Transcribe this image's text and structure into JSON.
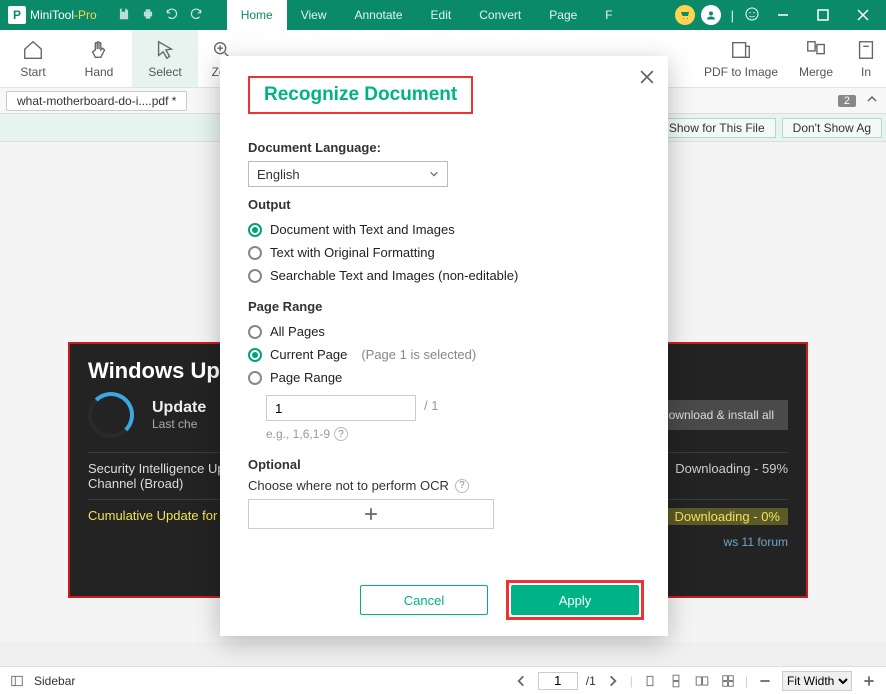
{
  "app": {
    "name_main": "MiniTool",
    "name_suffix": "-Pro"
  },
  "menu": {
    "items": [
      "Home",
      "View",
      "Annotate",
      "Edit",
      "Convert",
      "Page",
      "F"
    ],
    "active_index": 0
  },
  "toolbar": {
    "start": "Start",
    "hand": "Hand",
    "select": "Select",
    "zoom": "Zoo",
    "pdf_to_image": "PDF to Image",
    "merge": "Merge",
    "insert": "In"
  },
  "document_tab": {
    "label": "what-motherboard-do-i....pdf *"
  },
  "tabstrip": {
    "overflow_count": "2"
  },
  "infobar": {
    "dont_show_file": "n't Show for This File",
    "dont_show_all": "Don't Show Ag"
  },
  "page_preview": {
    "heading": "Windows Upd",
    "updates_title": "Update",
    "updates_sub": "Last che",
    "download_all": "Download & install all",
    "item1_text": "Security Intelligence Upd\nChannel (Broad)",
    "item1_status": "Downloading - 59%",
    "item2_text": "Cumulative Update for W",
    "item2_status": "Downloading - 0%",
    "forum_link": "ws 11 forum"
  },
  "dialog": {
    "title": "Recognize Document",
    "lang_label": "Document Language:",
    "lang_value": "English",
    "output_label": "Output",
    "output_opts": {
      "doc_text_images": "Document with Text and Images",
      "text_formatting": "Text with Original Formatting",
      "searchable": "Searchable Text and Images (non-editable)"
    },
    "range_label": "Page Range",
    "range_opts": {
      "all": "All Pages",
      "current": "Current Page",
      "current_note": "(Page 1 is selected)",
      "custom": "Page Range"
    },
    "range_input": "1",
    "range_total": "/ 1",
    "range_hint": "e.g., 1,6,1-9",
    "optional_label": "Optional",
    "optional_desc": "Choose where not to perform OCR",
    "btn_cancel": "Cancel",
    "btn_apply": "Apply"
  },
  "statusbar": {
    "sidebar_label": "Sidebar",
    "page_current": "1",
    "page_total": "/1",
    "zoom_mode": "Fit Width"
  },
  "colors": {
    "brand": "#0b8a6a",
    "accent": "#00b386",
    "callout": "#e33"
  }
}
